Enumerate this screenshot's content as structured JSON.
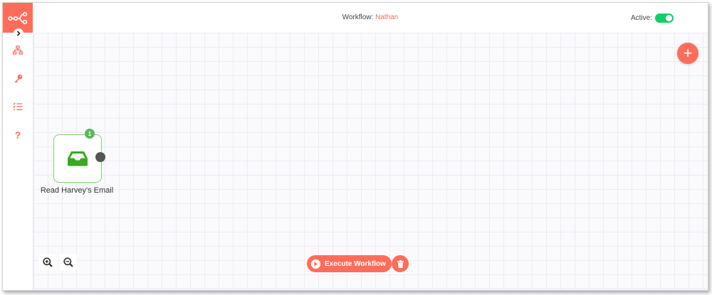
{
  "colors": {
    "accent": "#ff6d5a",
    "active_toggle": "#13ce66",
    "node_border": "#7dd36d",
    "node_icon": "#3aa823",
    "badge": "#5cb85c"
  },
  "sidebar": {
    "logo_icon": "n8n-logo-icon",
    "expand_icon": "chevron-right-icon",
    "items": [
      {
        "icon": "sitemap-icon",
        "tooltip": ""
      },
      {
        "icon": "key-icon",
        "tooltip": ""
      },
      {
        "icon": "task-list-icon",
        "tooltip": ""
      },
      {
        "icon": "question-icon",
        "text": "?"
      }
    ]
  },
  "header": {
    "workflow_label": "Workflow: ",
    "workflow_name": "Nathan",
    "active_label": "Active:",
    "active_state": true
  },
  "canvas": {
    "add_button": "+",
    "node": {
      "label": "Read Harvey's Email",
      "icon": "inbox-icon",
      "badge": "1"
    },
    "zoom_in_icon": "zoom-in-icon",
    "zoom_out_icon": "zoom-out-icon",
    "execute_label": "Execute Workflow",
    "delete_icon": "trash-icon"
  }
}
